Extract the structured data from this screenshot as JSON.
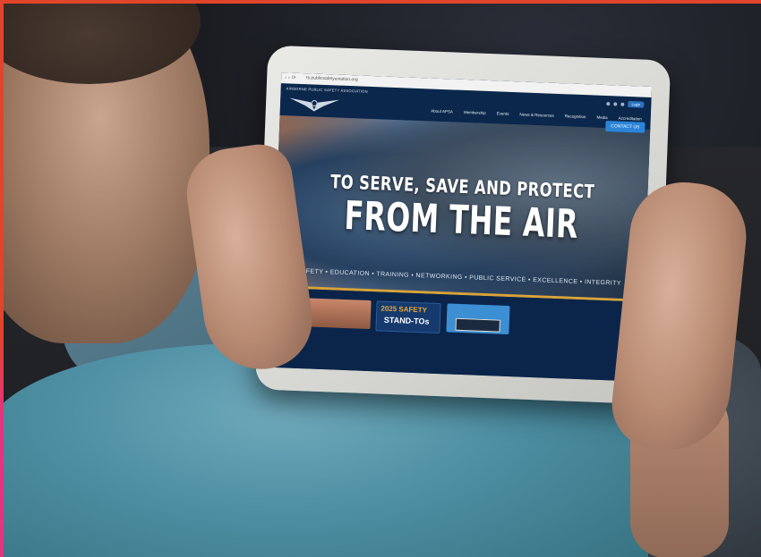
{
  "browser": {
    "url": "ts.publicsafetyaviation.org"
  },
  "site": {
    "logo_text": "AIRBORNE PUBLIC SAFETY ASSOCIATION",
    "nav": [
      "About APSA",
      "Membership",
      "Events",
      "News & Resources",
      "Recognition",
      "Media",
      "Accreditation"
    ],
    "util_button": "Login",
    "contact_button": "CONTACT US",
    "hero_line1": "TO SERVE, SAVE AND PROTECT",
    "hero_line2": "FROM THE AIR",
    "tagline": "SAFETY • EDUCATION • TRAINING • NETWORKING • PUBLIC SERVICE • EXCELLENCE • INTEGRITY",
    "card2_line1": "2025 SAFETY",
    "card2_line2": "STAND-TOs"
  },
  "colors": {
    "frame_accent": "#e0452b",
    "site_navy": "#0b274b",
    "gold": "#d7a43a",
    "contact_blue": "#2b84d8"
  }
}
